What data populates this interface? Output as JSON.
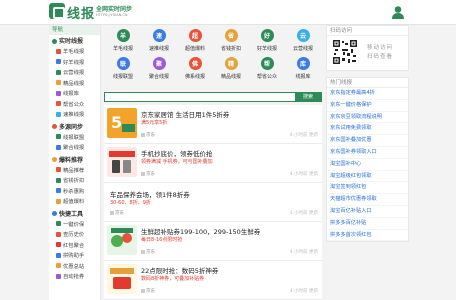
{
  "header": {
    "logo": "线报",
    "slogan": "全网实时同步",
    "url": "HTTPS://YXIAN.CN"
  },
  "sidebar": {
    "search_label": "导航",
    "groups": [
      {
        "title": "实时线报",
        "color": "#2e8b57",
        "items": [
          {
            "label": "羊毛线报",
            "color": "#e6553a"
          },
          {
            "label": "好羊线报",
            "color": "#3a7be6"
          },
          {
            "label": "云营线报",
            "color": "#2e8b57"
          },
          {
            "label": "精品线报",
            "color": "#e6a23a"
          },
          {
            "label": "线报库",
            "color": "#9a5ad8"
          },
          {
            "label": "帮省公众",
            "color": "#e6553a"
          },
          {
            "label": "速推线报",
            "color": "#3ab0e6"
          }
        ]
      },
      {
        "title": "多源同步",
        "color": "#e6553a",
        "items": [
          {
            "label": "线报联盟",
            "color": "#2e8b57"
          },
          {
            "label": "聚合线报",
            "color": "#3a7be6"
          }
        ]
      },
      {
        "title": "爆料推荐",
        "color": "#e6a23a",
        "items": [
          {
            "label": "精品推荐",
            "color": "#e6553a"
          },
          {
            "label": "省钱折扣",
            "color": "#2e8b57"
          },
          {
            "label": "秒杀惠购",
            "color": "#3a7be6"
          },
          {
            "label": "超值爆料",
            "color": "#e6a23a"
          }
        ]
      },
      {
        "title": "快捷工具",
        "color": "#3a7be6",
        "items": [
          {
            "label": "一键价保",
            "color": "#2e8b57"
          },
          {
            "label": "查历史价",
            "color": "#e6553a"
          },
          {
            "label": "红包聚合",
            "color": "#e23a2e"
          },
          {
            "label": "拼购助手",
            "color": "#3a7be6"
          },
          {
            "label": "优惠总站",
            "color": "#e6a23a"
          },
          {
            "label": "自动抢券",
            "color": "#9a5ad8"
          }
        ]
      }
    ]
  },
  "grid": [
    {
      "label": "羊毛线报",
      "color": "#2e8b57",
      "glyph": "羊"
    },
    {
      "label": "速推线报",
      "color": "#3a7be6",
      "glyph": "速"
    },
    {
      "label": "超值爆料",
      "color": "#e6553a",
      "glyph": "超"
    },
    {
      "label": "省钱折扣",
      "color": "#e6a23a",
      "glyph": "省"
    },
    {
      "label": "好羊线报",
      "color": "#2e8b57",
      "glyph": "好"
    },
    {
      "label": "云营线报",
      "color": "#3ab0e6",
      "glyph": "云"
    },
    {
      "label": "线报联盟",
      "color": "#3a7be6",
      "glyph": "联"
    },
    {
      "label": "聚合线报",
      "color": "#9a5ad8",
      "glyph": "聚"
    },
    {
      "label": "佛系线报",
      "color": "#e6553a",
      "glyph": "佛"
    },
    {
      "label": "精品线报",
      "color": "#e6a23a",
      "glyph": "精"
    },
    {
      "label": "帮省公众",
      "color": "#2e8b57",
      "glyph": "帮"
    },
    {
      "label": "线报库",
      "color": "#3a7be6",
      "glyph": "库"
    }
  ],
  "search": {
    "placeholder": "",
    "button": "搜索"
  },
  "posts": [
    {
      "title": "京东家居馆 生活日用1件5折券",
      "sub": "满5元享5折",
      "meta": "京东",
      "time": "4.小时前 更新",
      "thumb": "jd"
    },
    {
      "title": "手机抄底价，领券低价抢",
      "sub": "领券满减 手机券，可与国补叠加",
      "meta": "京东",
      "time": "4.小时前 更新",
      "thumb": "phone"
    },
    {
      "title": "车品保养会场，领1件8折券",
      "sub": "30-60、8折、9折",
      "meta": "京东",
      "time": "4.小时前 更新",
      "thumb": ""
    },
    {
      "title": "生鲜超补贴券199-100，299-150生鲜券",
      "sub": "每日8-16点限时抢",
      "meta": "京东",
      "time": "4.小时前 更新",
      "thumb": "fresh"
    },
    {
      "title": "22点限时抢：数码5折神券",
      "sub": "数码8折神券，可叠加补贴券",
      "meta": "京东",
      "time": "4.小时前 更新",
      "thumb": "digital"
    }
  ],
  "rpanel": {
    "qr_head": "扫码访问",
    "qr_text": [
      "移动访问",
      "扫码查看"
    ],
    "news_head": "热门线报",
    "news": [
      "京东指定券最高4折",
      "京东一键价格保护",
      "京东京豆领取流程说明",
      "京东试用免费领取",
      "京东国补叠加优惠",
      "京东国补券领取入口",
      "淘宝国补中心",
      "淘宝超级红包领取",
      "淘宝签到领红包",
      "天猫超市优惠券领取",
      "淘宝百亿补贴入口",
      "拼多多百亿补贴",
      "拼多多首次领红包"
    ]
  }
}
